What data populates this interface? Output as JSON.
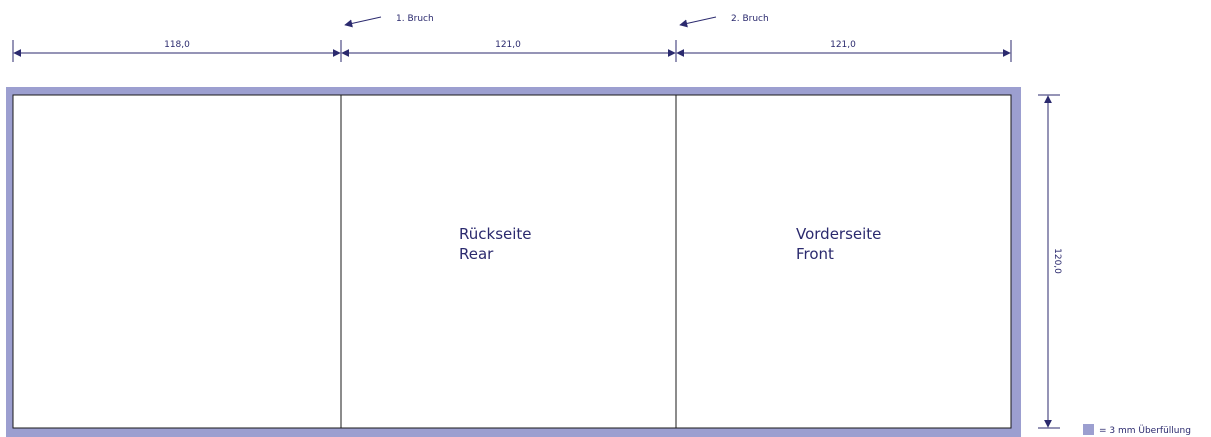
{
  "folds": {
    "first": "1. Bruch",
    "second": "2. Bruch"
  },
  "dimensions": {
    "panel1_width": "118,0",
    "panel2_width": "121,0",
    "panel3_width": "121,0",
    "height": "120,0"
  },
  "panels": [
    {
      "line1": "",
      "line2": ""
    },
    {
      "line1": "Rückseite",
      "line2": "Rear"
    },
    {
      "line1": "Vorderseite",
      "line2": "Front"
    }
  ],
  "legend": {
    "label": "= 3 mm Überfüllung",
    "color": "#9c9fd0"
  },
  "colors": {
    "line": "#2b2a6e",
    "bleed": "#9c9fd0"
  }
}
